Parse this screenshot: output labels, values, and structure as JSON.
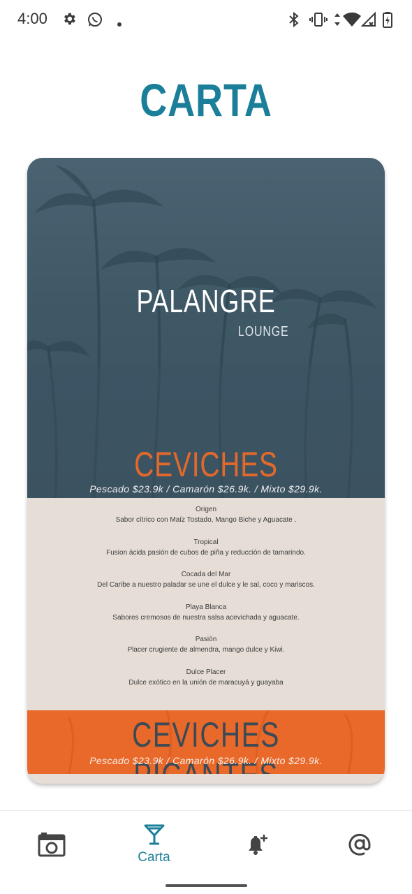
{
  "status_bar": {
    "time": "4:00"
  },
  "page": {
    "title": "CARTA"
  },
  "menu": {
    "brand": "PALANGRE",
    "brand_sub": "LOUNGE",
    "section": "CEVICHES",
    "prices": "Pescado $23.9k /    Camarón $26.9k.    / Mixto $29.9k.",
    "items": [
      {
        "name": "Origen",
        "desc": "Sabor cítrico con Maíz Tostado, Mango Biche y Aguacate ."
      },
      {
        "name": "Tropical",
        "desc": "Fusion ácida pasión de cubos de piña y reducción de tamarindo."
      },
      {
        "name": "Cocada del Mar",
        "desc": "Del Caribe a nuestro paladar se une el dulce y le sal, coco y mariscos."
      },
      {
        "name": "Playa Blanca",
        "desc": "Sabores cremosos de nuestra salsa acevichada y aguacate."
      },
      {
        "name": "Pasión",
        "desc": "Placer crugiente de almendra, mango dulce y Kiwi."
      },
      {
        "name": "Dulce Placer",
        "desc": "Dulce exótico en la unión de maracuyá y guayaba"
      }
    ],
    "spicy_section": "CEVICHES  PICANTES",
    "spicy_prices": "Pescado $23.9k /    Camarón $26.9k.    / Mixto $29.9k."
  },
  "bottom_nav": {
    "items": [
      {
        "icon": "camera-icon",
        "label": ""
      },
      {
        "icon": "cocktail-icon",
        "label": "Carta",
        "active": true
      },
      {
        "icon": "bell-plus-icon",
        "label": ""
      },
      {
        "icon": "at-sign-icon",
        "label": ""
      }
    ]
  },
  "colors": {
    "accent": "#1b7f9a",
    "orange": "#e8692a",
    "card_bg": "#e6ded6",
    "hero_bg": "#3f5866"
  }
}
